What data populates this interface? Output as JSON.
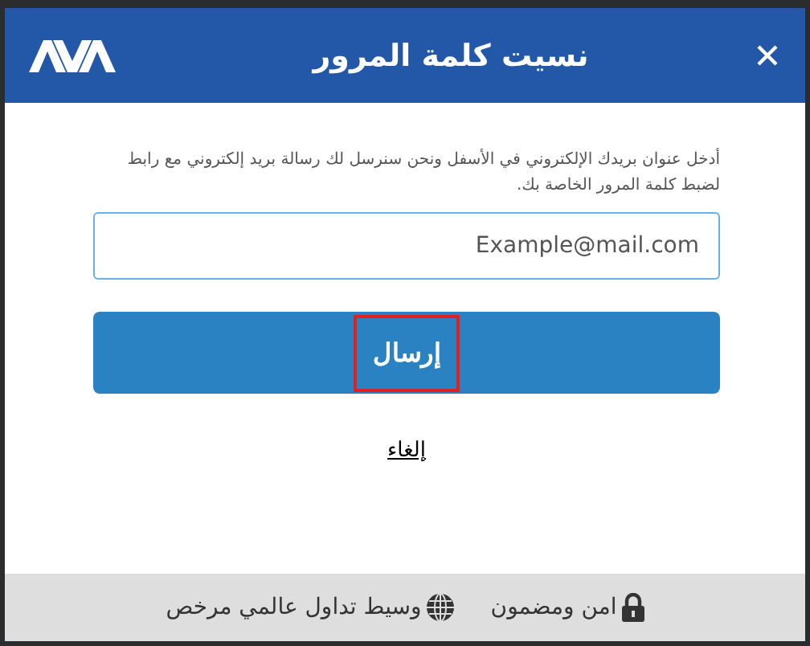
{
  "dialog": {
    "title": "نسيت كلمة المرور",
    "instructions": "أدخل عنوان بريدك الإلكتروني في الأسفل ونحن سنرسل لك رسالة بريد إلكتروني مع رابط لضبط كلمة المرور الخاصة بك.",
    "email": {
      "placeholder": "Example@mail.com"
    },
    "submit": {
      "label": "إرسال",
      "highlighted": true
    },
    "cancel": "إلغاء"
  },
  "footer": [
    {
      "kind": "lock",
      "text": "امن ومضمون"
    },
    {
      "kind": "globe",
      "text": "وسيط تداول عالمي مرخص"
    }
  ]
}
